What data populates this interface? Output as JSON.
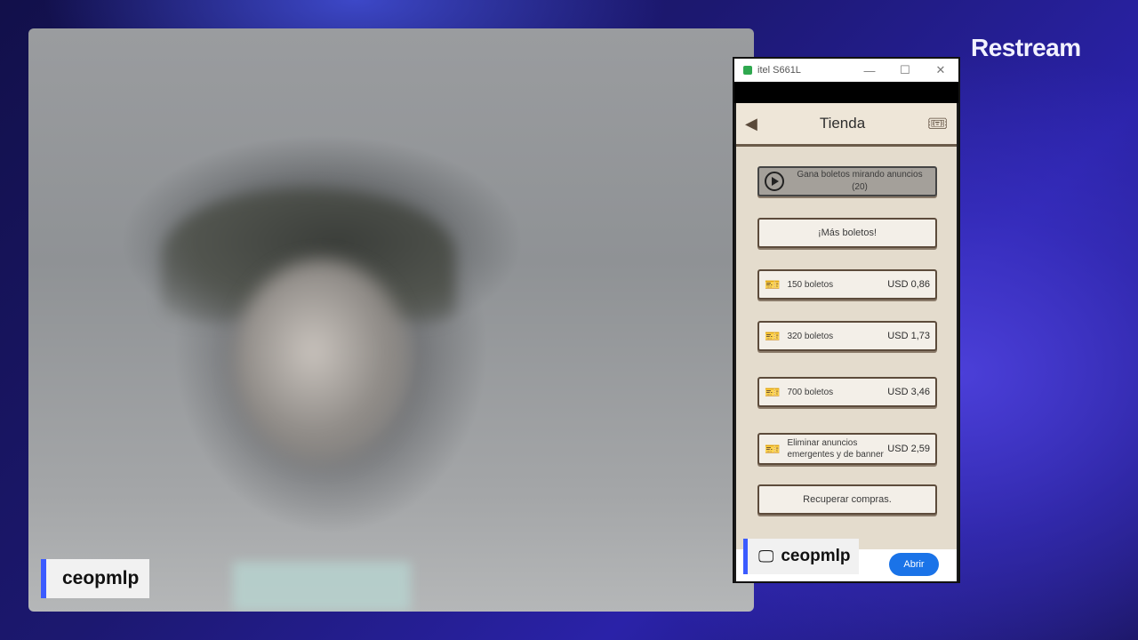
{
  "brand": "Restream",
  "camera": {
    "label": "ceopmlp"
  },
  "window": {
    "title": "itel S661L",
    "minimize": "—",
    "maximize": "☐",
    "close": "✕"
  },
  "shop": {
    "title": "Tienda",
    "items": [
      {
        "label": "Gana boletos mirando anuncios",
        "sub": "(20)"
      },
      {
        "label": "¡Más boletos!"
      },
      {
        "label": "150 boletos",
        "price": "USD 0,86"
      },
      {
        "label": "320 boletos",
        "price": "USD 1,73"
      },
      {
        "label": "700 boletos",
        "price": "USD 3,46"
      },
      {
        "label": "Eliminar anuncios emergentes y de banner",
        "price": "USD 2,59"
      },
      {
        "label": "Recuperar compras."
      }
    ]
  },
  "overlay": {
    "label": "ceopmlp"
  },
  "ad": {
    "button": "Abrir"
  }
}
